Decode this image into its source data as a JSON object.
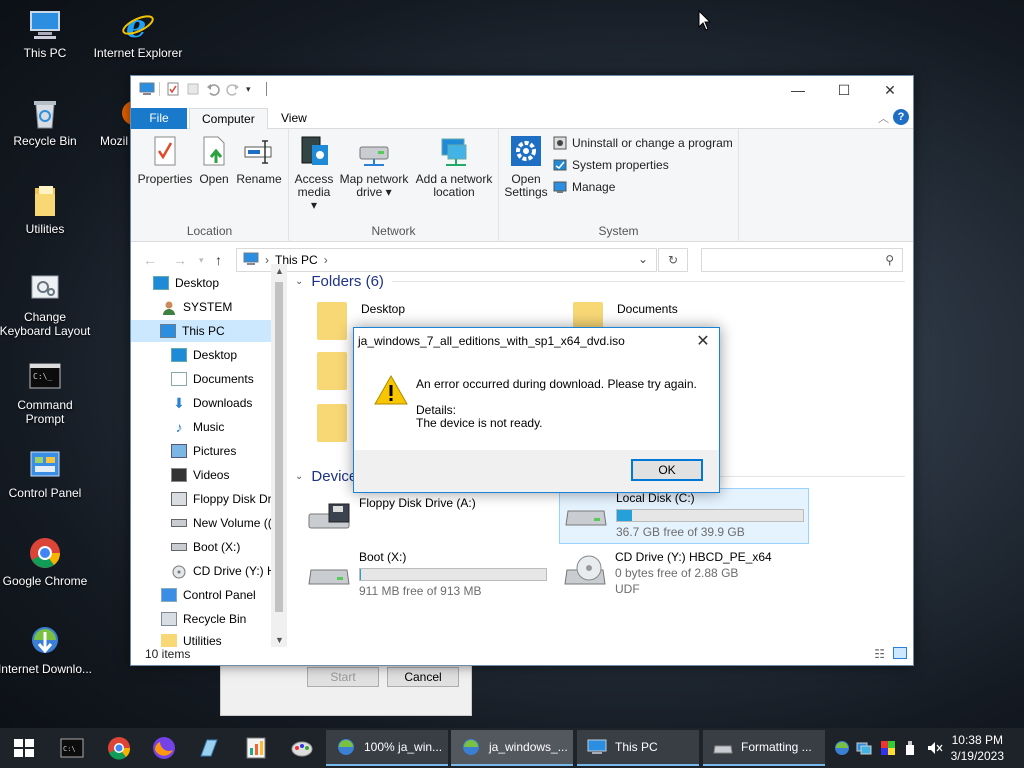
{
  "desktop": {
    "icons": [
      {
        "label": "This PC"
      },
      {
        "label": "Internet Explorer"
      },
      {
        "label": "Recycle Bin"
      },
      {
        "label": "Mozil"
      },
      {
        "label": "Utilities"
      },
      {
        "label": "Change Keyboard Layout"
      },
      {
        "label": "Command Prompt"
      },
      {
        "label": "Control Panel"
      },
      {
        "label": "Google Chrome"
      },
      {
        "label": "Internet Downlo..."
      }
    ]
  },
  "behind_window": {
    "start_label": "Start",
    "cancel_label": "Cancel"
  },
  "explorer": {
    "tabs": {
      "file": "File",
      "computer": "Computer",
      "view": "View"
    },
    "ribbon": {
      "location": {
        "group_label": "Location",
        "properties": "Properties",
        "open": "Open",
        "rename": "Rename"
      },
      "network": {
        "group_label": "Network",
        "access_media_1": "Access",
        "access_media_2": "media ▾",
        "map_drive_1": "Map network",
        "map_drive_2": "drive ▾",
        "add_location_1": "Add a network",
        "add_location_2": "location"
      },
      "system": {
        "group_label": "System",
        "open_settings_1": "Open",
        "open_settings_2": "Settings",
        "uninstall": "Uninstall or change a program",
        "system_properties": "System properties",
        "manage": "Manage"
      }
    },
    "address": {
      "path": "This PC",
      "search_placeholder": ""
    },
    "nav": [
      {
        "label": "Desktop"
      },
      {
        "label": "SYSTEM"
      },
      {
        "label": "This PC"
      },
      {
        "label": "Desktop"
      },
      {
        "label": "Documents"
      },
      {
        "label": "Downloads"
      },
      {
        "label": "Music"
      },
      {
        "label": "Pictures"
      },
      {
        "label": "Videos"
      },
      {
        "label": "Floppy Disk Dri"
      },
      {
        "label": "New Volume (("
      },
      {
        "label": "Boot (X:)"
      },
      {
        "label": "CD Drive (Y:) H"
      },
      {
        "label": "Control Panel"
      },
      {
        "label": "Recycle Bin"
      },
      {
        "label": "Utilities"
      }
    ],
    "folders_header": "Folders (6)",
    "folders": [
      {
        "label": "Desktop"
      },
      {
        "label": "Documents"
      }
    ],
    "devices_header": "Device",
    "drives": [
      {
        "name": "Floppy Disk Drive (A:)",
        "free": "",
        "used_fraction": null
      },
      {
        "name": "Local Disk (C:)",
        "free": "36.7 GB free of 39.9 GB",
        "used_fraction": 0.08
      },
      {
        "name": "Boot (X:)",
        "free": "911 MB free of 913 MB",
        "used_fraction": 0.002
      },
      {
        "name": "CD Drive (Y:) HBCD_PE_x64",
        "free": "0 bytes free of 2.88 GB",
        "extra": "UDF",
        "used_fraction": null
      }
    ],
    "status": "10 items"
  },
  "dialog": {
    "title": "ja_windows_7_all_editions_with_sp1_x64_dvd.iso",
    "message": "An error occurred during download. Please try again.",
    "details_label": "Details:",
    "details_text": "The device is not ready.",
    "ok_label": "OK"
  },
  "taskbar": {
    "tasks": [
      {
        "label": "100% ja_win..."
      },
      {
        "label": "ja_windows_..."
      },
      {
        "label": "This PC"
      },
      {
        "label": "Formatting ..."
      }
    ],
    "time": "10:38 PM",
    "date": "3/19/2023"
  },
  "colors": {
    "accent": "#0078d7",
    "ribbon_file_tab": "#1979ca",
    "selection": "#cce8ff",
    "taskbar": "#1e2329"
  }
}
